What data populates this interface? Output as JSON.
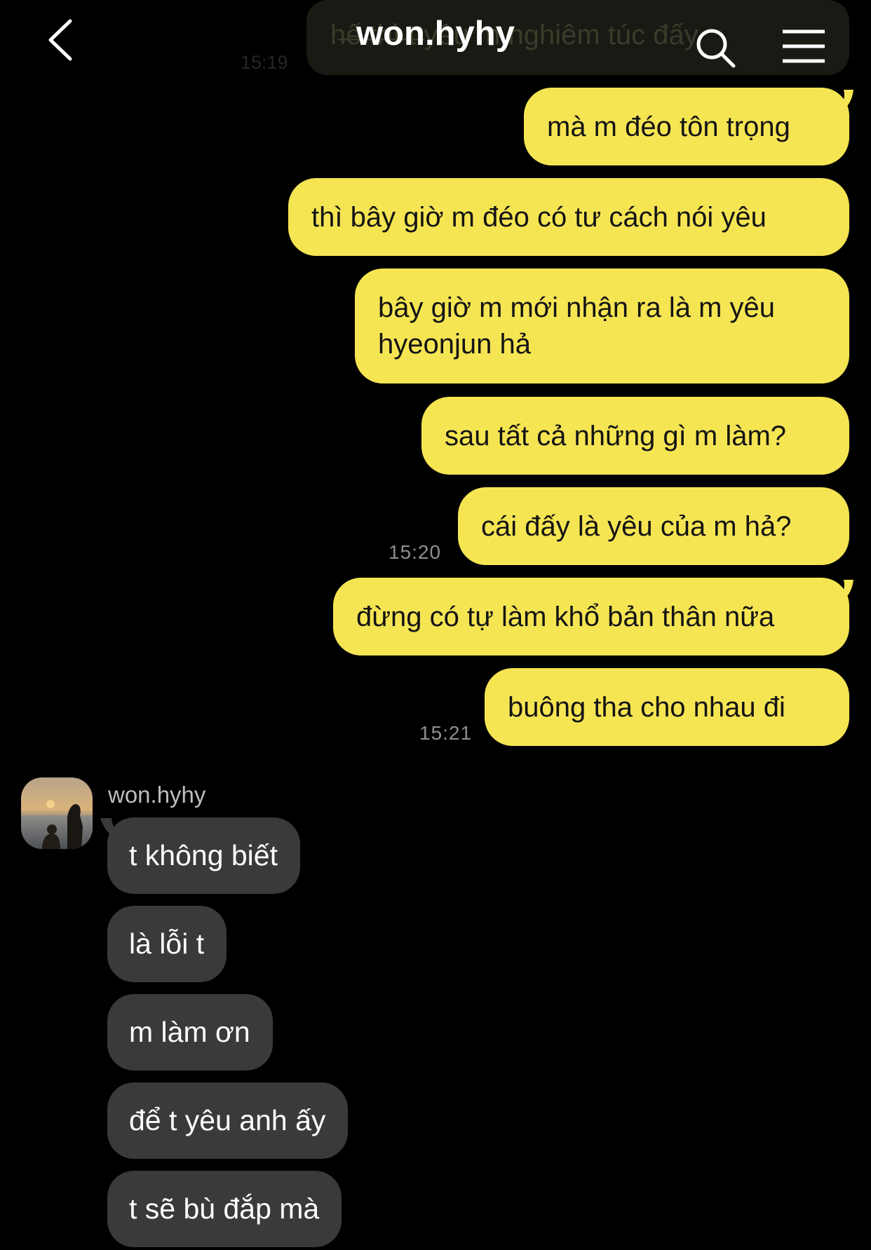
{
  "header": {
    "title": "won.hyhy",
    "back_icon": "chevron-left-icon",
    "search_icon": "search-icon",
    "menu_icon": "menu-icon"
  },
  "top_partial": {
    "text": "h̶ế̶ ̶t̶h̶ì̶ ̶t̶ yêu m nghiêm túc đấy",
    "time": "15:19"
  },
  "outgoing": [
    {
      "text": "mà m đéo tôn trọng"
    },
    {
      "text": "thì bây giờ m đéo có tư cách nói yêu"
    },
    {
      "line1": "bây giờ m mới nhận ra là m yêu",
      "line2": "hyeonjun hả"
    },
    {
      "text": "sau tất cả những gì m làm?"
    },
    {
      "text": "cái đấy là yêu của m hả?"
    },
    {
      "text": "đừng có tự làm khổ bản thân nữa"
    },
    {
      "text": "buông tha cho nhau đi"
    }
  ],
  "timestamps": {
    "t1": "15:20",
    "t2": "15:21"
  },
  "incoming": {
    "sender": "won.hyhy",
    "messages": [
      "t không biết",
      "là lỗi t",
      "m làm ơn",
      "để t yêu anh ấy",
      "t sẽ bù đắp mà"
    ]
  },
  "colors": {
    "background": "#000000",
    "outgoing_bubble": "#f6e553",
    "incoming_bubble": "#3a3a3c",
    "timestamp": "#8e8e8e"
  }
}
